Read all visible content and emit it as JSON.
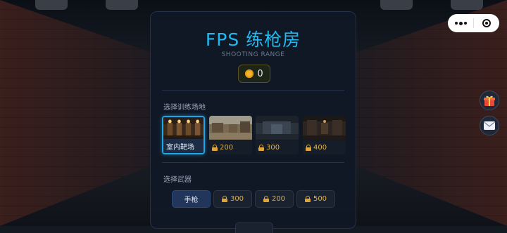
{
  "header": {
    "title": "FPS 练枪房",
    "subtitle": "SHOOTING RANGE"
  },
  "currency": {
    "value": "0",
    "icon": "coin-icon"
  },
  "map_section": {
    "label": "选择训练场地",
    "items": [
      {
        "label": "室内靶场",
        "locked": false,
        "selected": true
      },
      {
        "label": "200",
        "locked": true
      },
      {
        "label": "300",
        "locked": true
      },
      {
        "label": "400",
        "locked": true
      }
    ]
  },
  "weapon_section": {
    "label": "选择武器",
    "items": [
      {
        "label": "手枪",
        "locked": false,
        "selected": true
      },
      {
        "label": "300",
        "locked": true
      },
      {
        "label": "200",
        "locked": true
      },
      {
        "label": "500",
        "locked": true
      }
    ]
  },
  "side_buttons": [
    {
      "icon": "gift-icon"
    },
    {
      "icon": "mail-icon"
    }
  ],
  "colors": {
    "accent": "#20b9f0",
    "lock_price": "#e0b24a",
    "coin": "#f5b52a"
  }
}
